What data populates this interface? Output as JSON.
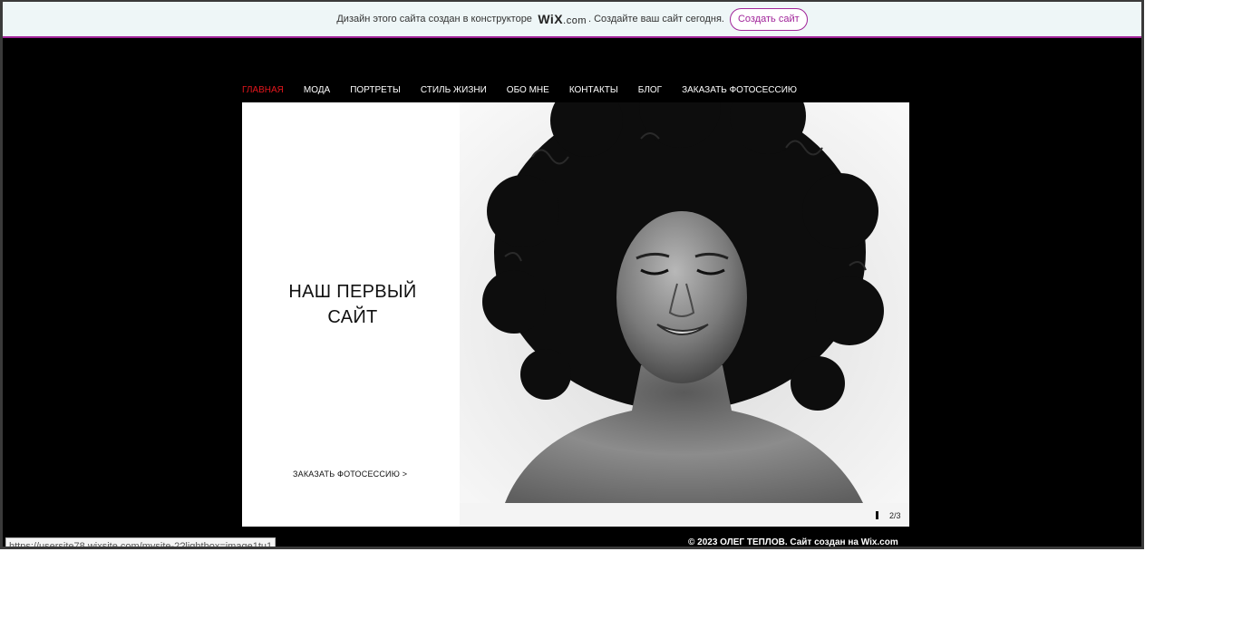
{
  "banner": {
    "text_before": "Дизайн этого сайта создан в конструкторе",
    "logo_main": "WiX",
    "logo_suffix": ".com",
    "text_after": ". Создайте ваш сайт сегодня.",
    "button_label": "Создать сайт",
    "accent_color": "#a1249a"
  },
  "nav": {
    "items": [
      {
        "label": "ГЛАВНАЯ",
        "active": true
      },
      {
        "label": "МОДА"
      },
      {
        "label": "ПОРТРЕТЫ"
      },
      {
        "label": "СТИЛЬ ЖИЗНИ"
      },
      {
        "label": "ОБО МНЕ"
      },
      {
        "label": "КОНТАКТЫ"
      },
      {
        "label": "БЛОГ"
      },
      {
        "label": "ЗАКАЗАТЬ ФОТОСЕССИЮ"
      }
    ],
    "active_color": "#e4161c"
  },
  "hero": {
    "title_line1": "НАШ ПЕРВЫЙ",
    "title_line2": "САЙТ",
    "cta": "ЗАКАЗАТЬ ФОТОСЕССИЮ >",
    "slide_counter": "2/3",
    "photo_alt": "black and white portrait of smiling woman with curly hair"
  },
  "footer": {
    "text": "© 2023 ОЛЕГ ТЕПЛОВ. Сайт создан на Wix.com"
  },
  "status": {
    "url": "https://usersite78.wixsite.com/mysite-2?lightbox=image1tu1"
  }
}
